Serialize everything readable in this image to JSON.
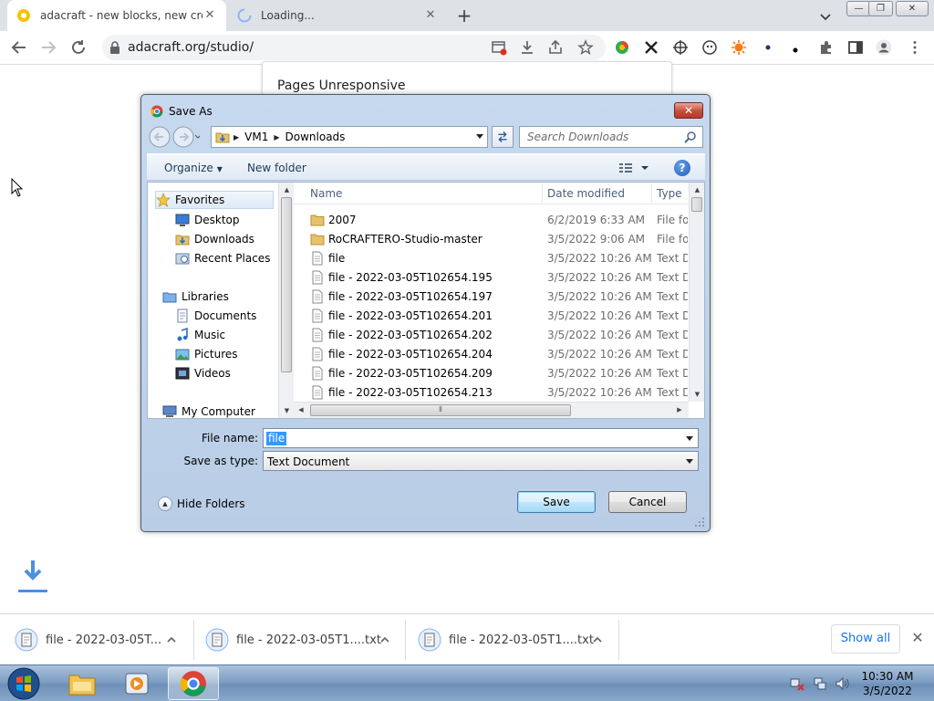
{
  "browser": {
    "tabs": [
      {
        "title": "adacraft - new blocks, new creati",
        "close": "✕"
      },
      {
        "title": "Loading...",
        "close": "✕"
      }
    ],
    "new_tab": "+",
    "window_controls": {
      "minimize": "—",
      "restore": "❐",
      "close": "✕"
    },
    "url": "adacraft.org/studio/"
  },
  "page": {
    "unresponsive_title": "Pages Unresponsive"
  },
  "dialog": {
    "title": "Save As",
    "close": "✕",
    "breadcrumb": [
      "VM1",
      "Downloads"
    ],
    "search_placeholder": "Search Downloads",
    "organize_label": "Organize",
    "new_folder_label": "New folder",
    "help": "?",
    "tree": [
      {
        "label": "Favorites",
        "icon": "star-icon"
      },
      {
        "label": "Desktop",
        "icon": "desktop-icon"
      },
      {
        "label": "Downloads",
        "icon": "downloads-folder-icon"
      },
      {
        "label": "Recent Places",
        "icon": "recent-places-icon"
      },
      {
        "label": "Libraries",
        "icon": "libraries-icon"
      },
      {
        "label": "Documents",
        "icon": "documents-icon"
      },
      {
        "label": "Music",
        "icon": "music-icon"
      },
      {
        "label": "Pictures",
        "icon": "pictures-icon"
      },
      {
        "label": "Videos",
        "icon": "videos-icon"
      },
      {
        "label": "My Computer",
        "icon": "computer-icon"
      }
    ],
    "columns": {
      "name": "Name",
      "date": "Date modified",
      "type": "Type"
    },
    "files": [
      {
        "name": "2007",
        "date": "6/2/2019 6:33 AM",
        "type": "File fol",
        "kind": "folder"
      },
      {
        "name": "RoCRAFTERO-Studio-master",
        "date": "3/5/2022 9:06 AM",
        "type": "File fol",
        "kind": "folder"
      },
      {
        "name": "file",
        "date": "3/5/2022 10:26 AM",
        "type": "Text D",
        "kind": "text"
      },
      {
        "name": "file - 2022-03-05T102654.195",
        "date": "3/5/2022 10:26 AM",
        "type": "Text D",
        "kind": "text"
      },
      {
        "name": "file - 2022-03-05T102654.197",
        "date": "3/5/2022 10:26 AM",
        "type": "Text D",
        "kind": "text"
      },
      {
        "name": "file - 2022-03-05T102654.201",
        "date": "3/5/2022 10:26 AM",
        "type": "Text D",
        "kind": "text"
      },
      {
        "name": "file - 2022-03-05T102654.202",
        "date": "3/5/2022 10:26 AM",
        "type": "Text D",
        "kind": "text"
      },
      {
        "name": "file - 2022-03-05T102654.204",
        "date": "3/5/2022 10:26 AM",
        "type": "Text D",
        "kind": "text"
      },
      {
        "name": "file - 2022-03-05T102654.209",
        "date": "3/5/2022 10:26 AM",
        "type": "Text D",
        "kind": "text"
      },
      {
        "name": "file - 2022-03-05T102654.213",
        "date": "3/5/2022 10:26 AM",
        "type": "Text D",
        "kind": "text"
      }
    ],
    "file_name_label": "File name:",
    "file_name_value": "file",
    "save_as_type_label": "Save as type:",
    "save_as_type_value": "Text Document",
    "hide_folders_label": "Hide Folders",
    "save_label": "Save",
    "cancel_label": "Cancel"
  },
  "downloads": {
    "items": [
      {
        "name": "file - 2022-03-05T..."
      },
      {
        "name": "file - 2022-03-05T1....txt"
      },
      {
        "name": "file - 2022-03-05T1....txt"
      }
    ],
    "show_all": "Show all",
    "close": "✕"
  },
  "taskbar": {
    "time": "10:30 AM",
    "date": "3/5/2022"
  },
  "colors": {
    "accent": "#1a73e8",
    "dialog_frame": "#b9cde6",
    "selection": "#3399ff"
  }
}
